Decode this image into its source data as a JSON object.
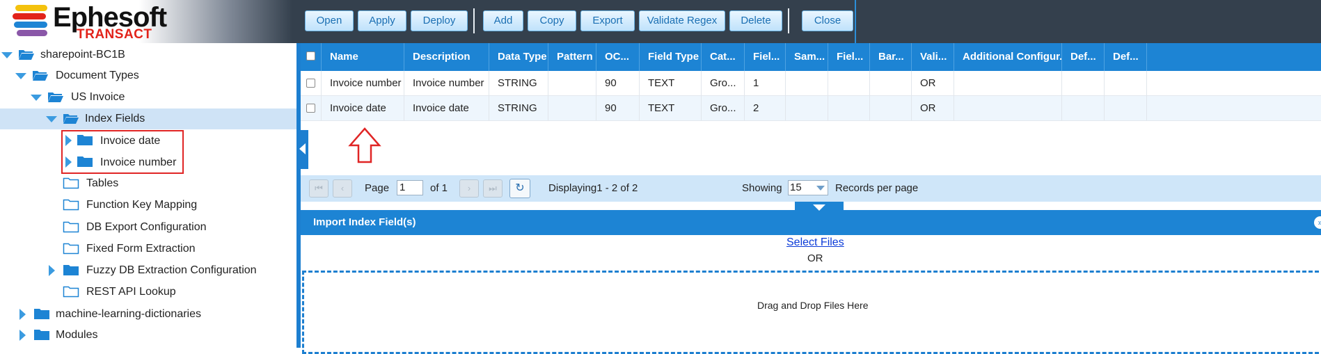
{
  "app": {
    "logo_main": "Ephesoft",
    "logo_sub": "TRANSACT"
  },
  "toolbar": {
    "buttons": [
      "Open",
      "Apply",
      "Deploy",
      "Add",
      "Copy",
      "Export",
      "Validate Regex",
      "Delete",
      "Close"
    ]
  },
  "tree": {
    "root": "sharepoint-BC1B",
    "document_types": "Document Types",
    "us_invoice": "US Invoice",
    "index_fields": "Index Fields",
    "invoice_date": "Invoice date",
    "invoice_number": "Invoice number",
    "tables": "Tables",
    "function_key_mapping": "Function Key Mapping",
    "db_export": "DB Export Configuration",
    "fixed_form": "Fixed Form Extraction",
    "fuzzy_db": "Fuzzy DB Extraction Configuration",
    "rest_api": "REST API Lookup",
    "ml_dictionaries": "machine-learning-dictionaries",
    "modules": "Modules"
  },
  "grid": {
    "columns": [
      "Name",
      "Description",
      "Data Type",
      "Pattern",
      "OC...",
      "Field Type",
      "Cat...",
      "Fiel...",
      "Sam...",
      "Fiel...",
      "Bar...",
      "Vali...",
      "Additional Configur...",
      "Def...",
      "Def..."
    ],
    "rows": [
      [
        "Invoice number",
        "Invoice number",
        "STRING",
        "",
        "90",
        "TEXT",
        "Gro...",
        "1",
        "",
        "",
        "",
        "OR",
        "",
        "",
        ""
      ],
      [
        "Invoice date",
        "Invoice date",
        "STRING",
        "",
        "90",
        "TEXT",
        "Gro...",
        "2",
        "",
        "",
        "",
        "OR",
        "",
        "",
        ""
      ]
    ]
  },
  "pager": {
    "page_label": "Page",
    "page_value": "1",
    "of_label": "of 1",
    "displaying": "Displaying1 - 2 of 2",
    "showing_label": "Showing",
    "per_page_value": "15",
    "records_label": "Records per page"
  },
  "import": {
    "title": "Import Index Field(s)",
    "select_files": "Select Files",
    "or": "OR",
    "drop_text": "Drag and Drop Files Here"
  },
  "colors": {
    "accent": "#1d84d4",
    "selection": "#cfe3f6",
    "highlight_red": "#e02525"
  }
}
